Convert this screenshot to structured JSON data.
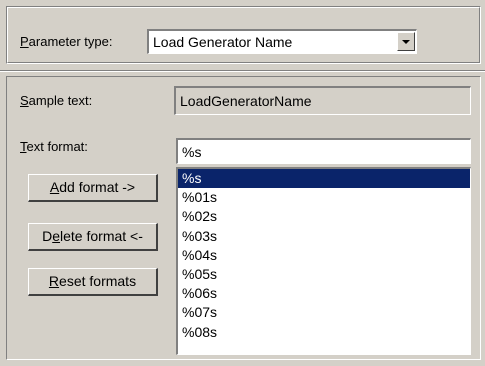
{
  "parameter_type": {
    "label_mnemonic": "P",
    "label_rest": "arameter type:",
    "selected_value": "Load Generator Name"
  },
  "sample_text": {
    "label_mnemonic": "S",
    "label_rest": "ample text:",
    "value": "LoadGeneratorName"
  },
  "text_format": {
    "label_mnemonic": "T",
    "label_rest": "ext format:",
    "value": "%s"
  },
  "buttons": {
    "add_format": {
      "mnemonic": "A",
      "rest": "dd format ->"
    },
    "delete_format": {
      "pre": "D",
      "mnemonic": "e",
      "rest": "lete format <-"
    },
    "reset_formats": {
      "mnemonic": "R",
      "rest": "eset formats"
    }
  },
  "format_list": {
    "items": [
      "%s",
      "%01s",
      "%02s",
      "%03s",
      "%04s",
      "%05s",
      "%06s",
      "%07s",
      "%08s"
    ],
    "selected_index": 0
  },
  "colors": {
    "dialog_bg": "#d4d0c8",
    "selection_bg": "#0a246a",
    "selection_fg": "#ffffff"
  }
}
